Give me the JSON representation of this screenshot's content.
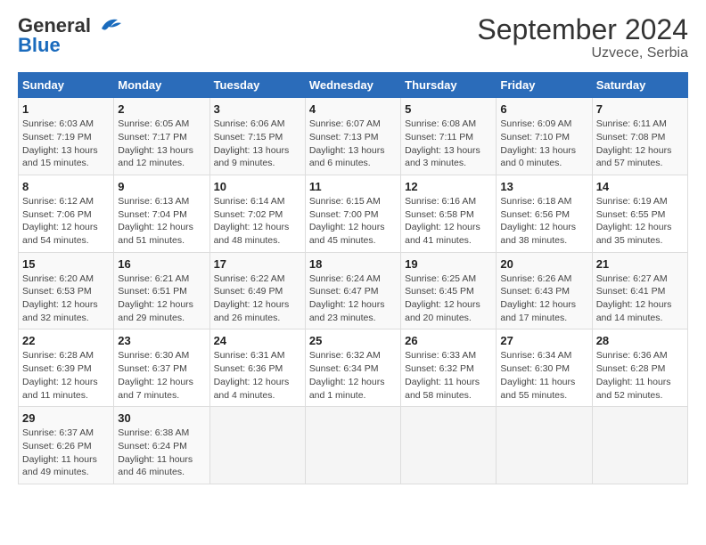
{
  "logo": {
    "line1": "General",
    "line2": "Blue"
  },
  "title": "September 2024",
  "subtitle": "Uzvece, Serbia",
  "days_of_week": [
    "Sunday",
    "Monday",
    "Tuesday",
    "Wednesday",
    "Thursday",
    "Friday",
    "Saturday"
  ],
  "weeks": [
    [
      {
        "day": "1",
        "sunrise": "Sunrise: 6:03 AM",
        "sunset": "Sunset: 7:19 PM",
        "daylight": "Daylight: 13 hours and 15 minutes."
      },
      {
        "day": "2",
        "sunrise": "Sunrise: 6:05 AM",
        "sunset": "Sunset: 7:17 PM",
        "daylight": "Daylight: 13 hours and 12 minutes."
      },
      {
        "day": "3",
        "sunrise": "Sunrise: 6:06 AM",
        "sunset": "Sunset: 7:15 PM",
        "daylight": "Daylight: 13 hours and 9 minutes."
      },
      {
        "day": "4",
        "sunrise": "Sunrise: 6:07 AM",
        "sunset": "Sunset: 7:13 PM",
        "daylight": "Daylight: 13 hours and 6 minutes."
      },
      {
        "day": "5",
        "sunrise": "Sunrise: 6:08 AM",
        "sunset": "Sunset: 7:11 PM",
        "daylight": "Daylight: 13 hours and 3 minutes."
      },
      {
        "day": "6",
        "sunrise": "Sunrise: 6:09 AM",
        "sunset": "Sunset: 7:10 PM",
        "daylight": "Daylight: 13 hours and 0 minutes."
      },
      {
        "day": "7",
        "sunrise": "Sunrise: 6:11 AM",
        "sunset": "Sunset: 7:08 PM",
        "daylight": "Daylight: 12 hours and 57 minutes."
      }
    ],
    [
      {
        "day": "8",
        "sunrise": "Sunrise: 6:12 AM",
        "sunset": "Sunset: 7:06 PM",
        "daylight": "Daylight: 12 hours and 54 minutes."
      },
      {
        "day": "9",
        "sunrise": "Sunrise: 6:13 AM",
        "sunset": "Sunset: 7:04 PM",
        "daylight": "Daylight: 12 hours and 51 minutes."
      },
      {
        "day": "10",
        "sunrise": "Sunrise: 6:14 AM",
        "sunset": "Sunset: 7:02 PM",
        "daylight": "Daylight: 12 hours and 48 minutes."
      },
      {
        "day": "11",
        "sunrise": "Sunrise: 6:15 AM",
        "sunset": "Sunset: 7:00 PM",
        "daylight": "Daylight: 12 hours and 45 minutes."
      },
      {
        "day": "12",
        "sunrise": "Sunrise: 6:16 AM",
        "sunset": "Sunset: 6:58 PM",
        "daylight": "Daylight: 12 hours and 41 minutes."
      },
      {
        "day": "13",
        "sunrise": "Sunrise: 6:18 AM",
        "sunset": "Sunset: 6:56 PM",
        "daylight": "Daylight: 12 hours and 38 minutes."
      },
      {
        "day": "14",
        "sunrise": "Sunrise: 6:19 AM",
        "sunset": "Sunset: 6:55 PM",
        "daylight": "Daylight: 12 hours and 35 minutes."
      }
    ],
    [
      {
        "day": "15",
        "sunrise": "Sunrise: 6:20 AM",
        "sunset": "Sunset: 6:53 PM",
        "daylight": "Daylight: 12 hours and 32 minutes."
      },
      {
        "day": "16",
        "sunrise": "Sunrise: 6:21 AM",
        "sunset": "Sunset: 6:51 PM",
        "daylight": "Daylight: 12 hours and 29 minutes."
      },
      {
        "day": "17",
        "sunrise": "Sunrise: 6:22 AM",
        "sunset": "Sunset: 6:49 PM",
        "daylight": "Daylight: 12 hours and 26 minutes."
      },
      {
        "day": "18",
        "sunrise": "Sunrise: 6:24 AM",
        "sunset": "Sunset: 6:47 PM",
        "daylight": "Daylight: 12 hours and 23 minutes."
      },
      {
        "day": "19",
        "sunrise": "Sunrise: 6:25 AM",
        "sunset": "Sunset: 6:45 PM",
        "daylight": "Daylight: 12 hours and 20 minutes."
      },
      {
        "day": "20",
        "sunrise": "Sunrise: 6:26 AM",
        "sunset": "Sunset: 6:43 PM",
        "daylight": "Daylight: 12 hours and 17 minutes."
      },
      {
        "day": "21",
        "sunrise": "Sunrise: 6:27 AM",
        "sunset": "Sunset: 6:41 PM",
        "daylight": "Daylight: 12 hours and 14 minutes."
      }
    ],
    [
      {
        "day": "22",
        "sunrise": "Sunrise: 6:28 AM",
        "sunset": "Sunset: 6:39 PM",
        "daylight": "Daylight: 12 hours and 11 minutes."
      },
      {
        "day": "23",
        "sunrise": "Sunrise: 6:30 AM",
        "sunset": "Sunset: 6:37 PM",
        "daylight": "Daylight: 12 hours and 7 minutes."
      },
      {
        "day": "24",
        "sunrise": "Sunrise: 6:31 AM",
        "sunset": "Sunset: 6:36 PM",
        "daylight": "Daylight: 12 hours and 4 minutes."
      },
      {
        "day": "25",
        "sunrise": "Sunrise: 6:32 AM",
        "sunset": "Sunset: 6:34 PM",
        "daylight": "Daylight: 12 hours and 1 minute."
      },
      {
        "day": "26",
        "sunrise": "Sunrise: 6:33 AM",
        "sunset": "Sunset: 6:32 PM",
        "daylight": "Daylight: 11 hours and 58 minutes."
      },
      {
        "day": "27",
        "sunrise": "Sunrise: 6:34 AM",
        "sunset": "Sunset: 6:30 PM",
        "daylight": "Daylight: 11 hours and 55 minutes."
      },
      {
        "day": "28",
        "sunrise": "Sunrise: 6:36 AM",
        "sunset": "Sunset: 6:28 PM",
        "daylight": "Daylight: 11 hours and 52 minutes."
      }
    ],
    [
      {
        "day": "29",
        "sunrise": "Sunrise: 6:37 AM",
        "sunset": "Sunset: 6:26 PM",
        "daylight": "Daylight: 11 hours and 49 minutes."
      },
      {
        "day": "30",
        "sunrise": "Sunrise: 6:38 AM",
        "sunset": "Sunset: 6:24 PM",
        "daylight": "Daylight: 11 hours and 46 minutes."
      },
      null,
      null,
      null,
      null,
      null
    ]
  ]
}
